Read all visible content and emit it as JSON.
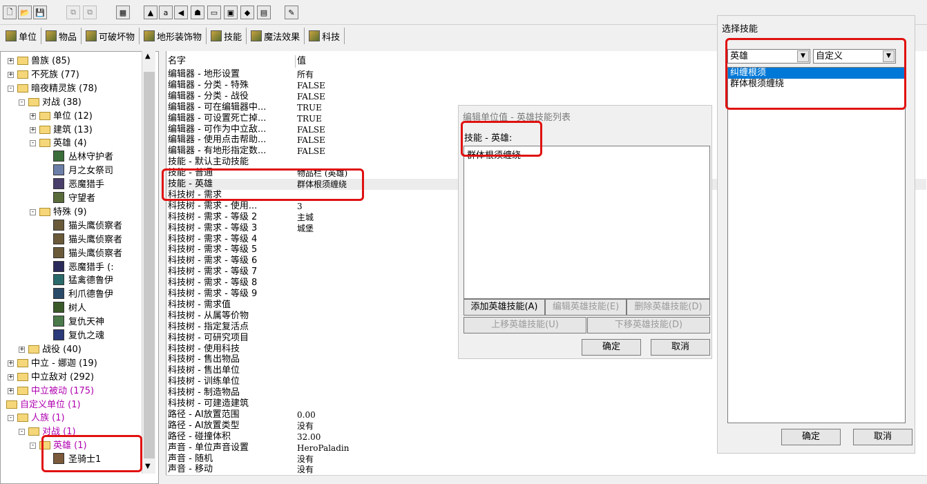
{
  "toolbar": {
    "icons": [
      "new-file",
      "open-folder",
      "save",
      "copy",
      "paste",
      "object-editor",
      "terrain",
      "shop",
      "sound",
      "unit",
      "import",
      "minimap",
      "cube",
      "script",
      "palette"
    ]
  },
  "tabs": [
    {
      "label": "单位"
    },
    {
      "label": "物品"
    },
    {
      "label": "可破坏物"
    },
    {
      "label": "地形装饰物"
    },
    {
      "label": "技能"
    },
    {
      "label": "魔法效果"
    },
    {
      "label": "科技"
    }
  ],
  "tree": {
    "rows": [
      {
        "label": "兽族 (85)",
        "type": "folder",
        "exp": "+",
        "indent": 0,
        "color": "normal"
      },
      {
        "label": "不死族 (77)",
        "type": "folder",
        "exp": "+",
        "indent": 0,
        "color": "normal"
      },
      {
        "label": "暗夜精灵族 (78)",
        "type": "folder",
        "exp": "-",
        "indent": 0,
        "color": "normal"
      },
      {
        "label": "对战 (38)",
        "type": "folder",
        "exp": "-",
        "indent": 1,
        "color": "normal"
      },
      {
        "label": "单位 (12)",
        "type": "folder",
        "exp": "+",
        "indent": 2,
        "color": "normal"
      },
      {
        "label": "建筑 (13)",
        "type": "folder",
        "exp": "+",
        "indent": 2,
        "color": "normal"
      },
      {
        "label": "英雄 (4)",
        "type": "folder",
        "exp": "-",
        "indent": 2,
        "color": "normal"
      },
      {
        "label": "丛林守护者",
        "type": "unit",
        "indent": 3,
        "color": "normal",
        "icon": "#3b6e3a"
      },
      {
        "label": "月之女祭司",
        "type": "unit",
        "indent": 3,
        "color": "normal",
        "icon": "#6c7fa8"
      },
      {
        "label": "恶魔猎手",
        "type": "unit",
        "indent": 3,
        "color": "normal",
        "icon": "#4a3f6b"
      },
      {
        "label": "守望者",
        "type": "unit",
        "indent": 3,
        "color": "normal",
        "icon": "#5a6b3a"
      },
      {
        "label": "特殊 (9)",
        "type": "folder",
        "exp": "-",
        "indent": 2,
        "color": "normal"
      },
      {
        "label": "猫头鹰侦察者",
        "type": "unit",
        "indent": 3,
        "color": "normal",
        "icon": "#6a5a3a"
      },
      {
        "label": "猫头鹰侦察者",
        "type": "unit",
        "indent": 3,
        "color": "normal",
        "icon": "#6a5a3a"
      },
      {
        "label": "猫头鹰侦察者",
        "type": "unit",
        "indent": 3,
        "color": "normal",
        "icon": "#6a5a3a"
      },
      {
        "label": "恶魔猎手 (:",
        "type": "unit",
        "indent": 3,
        "color": "normal",
        "icon": "#2a2a5a"
      },
      {
        "label": "猛禽德鲁伊",
        "type": "unit",
        "indent": 3,
        "color": "normal",
        "icon": "#2a6a6a"
      },
      {
        "label": "利爪德鲁伊",
        "type": "unit",
        "indent": 3,
        "color": "normal",
        "icon": "#2a4a6a"
      },
      {
        "label": "树人",
        "type": "unit",
        "indent": 3,
        "color": "normal",
        "icon": "#3a5a2a"
      },
      {
        "label": "复仇天神",
        "type": "unit",
        "indent": 3,
        "color": "normal",
        "icon": "#4a7a4a"
      },
      {
        "label": "复仇之魂",
        "type": "unit",
        "indent": 3,
        "color": "normal",
        "icon": "#2a3a7a"
      },
      {
        "label": "战役 (40)",
        "type": "folder",
        "exp": "+",
        "indent": 1,
        "color": "normal"
      },
      {
        "label": "中立 - 娜迦 (19)",
        "type": "folder",
        "exp": "+",
        "indent": 0,
        "color": "normal"
      },
      {
        "label": "中立敌对 (292)",
        "type": "folder",
        "exp": "+",
        "indent": 0,
        "color": "normal"
      },
      {
        "label": "中立被动 (175)",
        "type": "folder",
        "exp": "+",
        "indent": 0,
        "color": "magenta"
      },
      {
        "label": "自定义单位 (1)",
        "type": "folder",
        "exp": "",
        "indent": -1,
        "color": "magenta"
      },
      {
        "label": "人族 (1)",
        "type": "folder",
        "exp": "-",
        "indent": 0,
        "color": "magenta"
      },
      {
        "label": "对战 (1)",
        "type": "folder",
        "exp": "-",
        "indent": 1,
        "color": "magenta"
      },
      {
        "label": "英雄 (1)",
        "type": "folder",
        "exp": "-",
        "indent": 2,
        "color": "magenta"
      },
      {
        "label": "圣骑士1",
        "type": "unit",
        "indent": 3,
        "color": "normal",
        "icon": "#7a5a3a"
      }
    ]
  },
  "grid": {
    "col_name": "名字",
    "col_value": "值",
    "rows": [
      {
        "name": "编辑器 - 地形设置",
        "value": "所有"
      },
      {
        "name": "编辑器 - 分类 - 特殊",
        "value": "FALSE"
      },
      {
        "name": "编辑器 - 分类 - 战役",
        "value": "FALSE"
      },
      {
        "name": "编辑器 - 可在编辑器中...",
        "value": "TRUE"
      },
      {
        "name": "编辑器 - 可设置死亡掉...",
        "value": "TRUE"
      },
      {
        "name": "编辑器 - 可作为中立敌...",
        "value": "FALSE"
      },
      {
        "name": "编辑器 - 使用点击帮助...",
        "value": "FALSE"
      },
      {
        "name": "编辑器 - 有地形指定数...",
        "value": "FALSE"
      },
      {
        "name": "技能 - 默认主动技能",
        "value": ""
      },
      {
        "name": "技能 - 普通",
        "value": "物品栏 (英雄)"
      },
      {
        "name": "技能 - 英雄",
        "value": "群体根须缠绕"
      },
      {
        "name": "科技树 - 需求",
        "value": ""
      },
      {
        "name": "科技树 - 需求 - 使用...",
        "value": "3"
      },
      {
        "name": "科技树 - 需求 - 等级 2",
        "value": "主城"
      },
      {
        "name": "科技树 - 需求 - 等级 3",
        "value": "城堡"
      },
      {
        "name": "科技树 - 需求 - 等级 4",
        "value": ""
      },
      {
        "name": "科技树 - 需求 - 等级 5",
        "value": ""
      },
      {
        "name": "科技树 - 需求 - 等级 6",
        "value": ""
      },
      {
        "name": "科技树 - 需求 - 等级 7",
        "value": ""
      },
      {
        "name": "科技树 - 需求 - 等级 8",
        "value": ""
      },
      {
        "name": "科技树 - 需求 - 等级 9",
        "value": ""
      },
      {
        "name": "科技树 - 需求值",
        "value": ""
      },
      {
        "name": "科技树 - 从属等价物",
        "value": ""
      },
      {
        "name": "科技树 - 指定复活点",
        "value": ""
      },
      {
        "name": "科技树 - 可研究项目",
        "value": ""
      },
      {
        "name": "科技树 - 使用科技",
        "value": ""
      },
      {
        "name": "科技树 - 售出物品",
        "value": ""
      },
      {
        "name": "科技树 - 售出单位",
        "value": ""
      },
      {
        "name": "科技树 - 训练单位",
        "value": ""
      },
      {
        "name": "科技树 - 制造物品",
        "value": ""
      },
      {
        "name": "科技树 - 可建造建筑",
        "value": ""
      },
      {
        "name": "路径 - AI放置范围",
        "value": "0.00"
      },
      {
        "name": "路径 - AI放置类型",
        "value": "没有"
      },
      {
        "name": "路径 - 碰撞体积",
        "value": "32.00"
      },
      {
        "name": "声音 - 单位声音设置",
        "value": "HeroPaladin"
      },
      {
        "name": "声音 - 随机",
        "value": "没有"
      },
      {
        "name": "声音 - 移动",
        "value": "没有"
      }
    ]
  },
  "dialog": {
    "title": "编辑单位值 - 英雄技能列表",
    "label": "技能 - 英雄:",
    "items": [
      "群体根须缠绕"
    ],
    "add_btn": "添加英雄技能(A)",
    "edit_btn": "编辑英雄技能(E)",
    "del_btn": "删除英雄技能(D)",
    "up_btn": "上移英雄技能(U)",
    "down_btn": "下移英雄技能(D)",
    "ok_btn": "确定",
    "cancel_btn": "取消"
  },
  "skill_picker": {
    "title": "选择技能",
    "combo1": "英雄",
    "combo2": "自定义",
    "items": [
      {
        "label": "纠缠根须",
        "selected": true
      },
      {
        "label": "群体根须缠绕",
        "selected": false
      }
    ],
    "ok_btn": "确定",
    "cancel_btn": "取消"
  },
  "colors": {
    "highlight": "#e01010",
    "selection": "#0078d7",
    "custom_text": "#b000b0"
  }
}
